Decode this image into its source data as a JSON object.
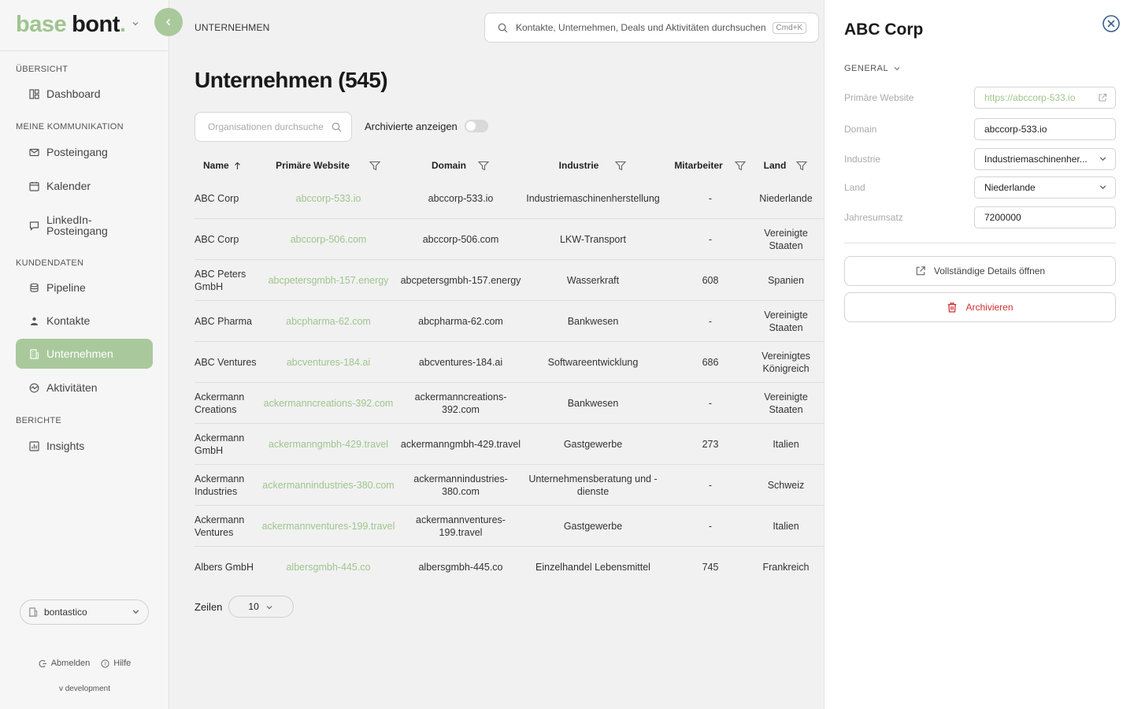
{
  "brand": {
    "part1": "base",
    "part2": "bont",
    "dot": "."
  },
  "sidebar": {
    "sections": [
      {
        "label": "ÜBERSICHT"
      },
      {
        "label": "MEINE KOMMUNIKATION"
      },
      {
        "label": "KUNDENDATEN"
      },
      {
        "label": "BERICHTE"
      }
    ],
    "items": [
      {
        "label": "Dashboard",
        "icon": "dashboard-icon"
      },
      {
        "label": "Posteingang",
        "icon": "mail-icon"
      },
      {
        "label": "Kalender",
        "icon": "calendar-icon"
      },
      {
        "label": "LinkedIn-",
        "label2": "Posteingang",
        "icon": "chat-icon"
      },
      {
        "label": "Pipeline",
        "icon": "database-icon"
      },
      {
        "label": "Kontakte",
        "icon": "contacts-icon"
      },
      {
        "label": "Unternehmen",
        "icon": "building-icon",
        "active": true
      },
      {
        "label": "Aktivitäten",
        "icon": "activity-icon"
      },
      {
        "label": "Insights",
        "icon": "chart-icon"
      }
    ],
    "tenant": "bontastico",
    "logout": "Abmelden",
    "help": "Hilfe",
    "version": "v development"
  },
  "header": {
    "breadcrumb": "UNTERNEHMEN",
    "search_placeholder": "Kontakte, Unternehmen, Deals und Aktivitäten durchsuchen",
    "search_shortcut": "Cmd+K"
  },
  "main": {
    "title": "Unternehmen (545)",
    "org_search_placeholder": "Organisationen durchsuche",
    "archived_label": "Archivierte anzeigen",
    "archived_on": false,
    "columns": [
      "Name",
      "Primäre Website",
      "Domain",
      "Industrie",
      "Mitarbeiter",
      "Land"
    ],
    "rows": [
      {
        "name": "ABC Corp",
        "website": "abccorp-533.io",
        "domain": "abccorp-533.io",
        "industry": "Industriemaschinenherstellung",
        "employees": "-",
        "country": "Niederlande"
      },
      {
        "name": "ABC Corp",
        "website": "abccorp-506.com",
        "domain": "abccorp-506.com",
        "industry": "LKW-Transport",
        "employees": "-",
        "country": "Vereinigte Staaten"
      },
      {
        "name": "ABC Peters GmbH",
        "website": "abcpetersgmbh-157.energy",
        "domain": "abcpetersgmbh-157.energy",
        "industry": "Wasserkraft",
        "employees": "608",
        "country": "Spanien"
      },
      {
        "name": "ABC Pharma",
        "website": "abcpharma-62.com",
        "domain": "abcpharma-62.com",
        "industry": "Bankwesen",
        "employees": "-",
        "country": "Vereinigte Staaten"
      },
      {
        "name": "ABC Ventures",
        "website": "abcventures-184.ai",
        "domain": "abcventures-184.ai",
        "industry": "Softwareentwicklung",
        "employees": "686",
        "country": "Vereinigtes Königreich"
      },
      {
        "name": "Ackermann Creations",
        "website": "ackermanncreations-392.com",
        "domain": "ackermanncreations-392.com",
        "industry": "Bankwesen",
        "employees": "-",
        "country": "Vereinigte Staaten"
      },
      {
        "name": "Ackermann GmbH",
        "website": "ackermanngmbh-429.travel",
        "domain": "ackermanngmbh-429.travel",
        "industry": "Gastgewerbe",
        "employees": "273",
        "country": "Italien"
      },
      {
        "name": "Ackermann Industries",
        "website": "ackermannindustries-380.com",
        "domain": "ackermannindustries-380.com",
        "industry": "Unternehmensberatung und -dienste",
        "employees": "-",
        "country": "Schweiz"
      },
      {
        "name": "Ackermann Ventures",
        "website": "ackermannventures-199.travel",
        "domain": "ackermannventures-199.travel",
        "industry": "Gastgewerbe",
        "employees": "-",
        "country": "Italien"
      },
      {
        "name": "Albers GmbH",
        "website": "albersgmbh-445.co",
        "domain": "albersgmbh-445.co",
        "industry": "Einzelhandel Lebensmittel",
        "employees": "745",
        "country": "Frankreich"
      }
    ],
    "rows_label": "Zeilen",
    "rows_value": "10"
  },
  "drawer": {
    "title": "ABC Corp",
    "section": "GENERAL",
    "fields": {
      "website_label": "Primäre Website",
      "website_value": "https://abccorp-533.io",
      "domain_label": "Domain",
      "domain_value": "abccorp-533.io",
      "industry_label": "Industrie",
      "industry_value": "Industriemaschinenher...",
      "country_label": "Land",
      "country_value": "Niederlande",
      "revenue_label": "Jahresumsatz",
      "revenue_value": "7200000"
    },
    "open_details": "Vollständige Details öffnen",
    "archive": "Archivieren"
  },
  "colors": {
    "accent": "#a9c99c",
    "link": "#9fc58e",
    "danger": "#d12f2f"
  }
}
